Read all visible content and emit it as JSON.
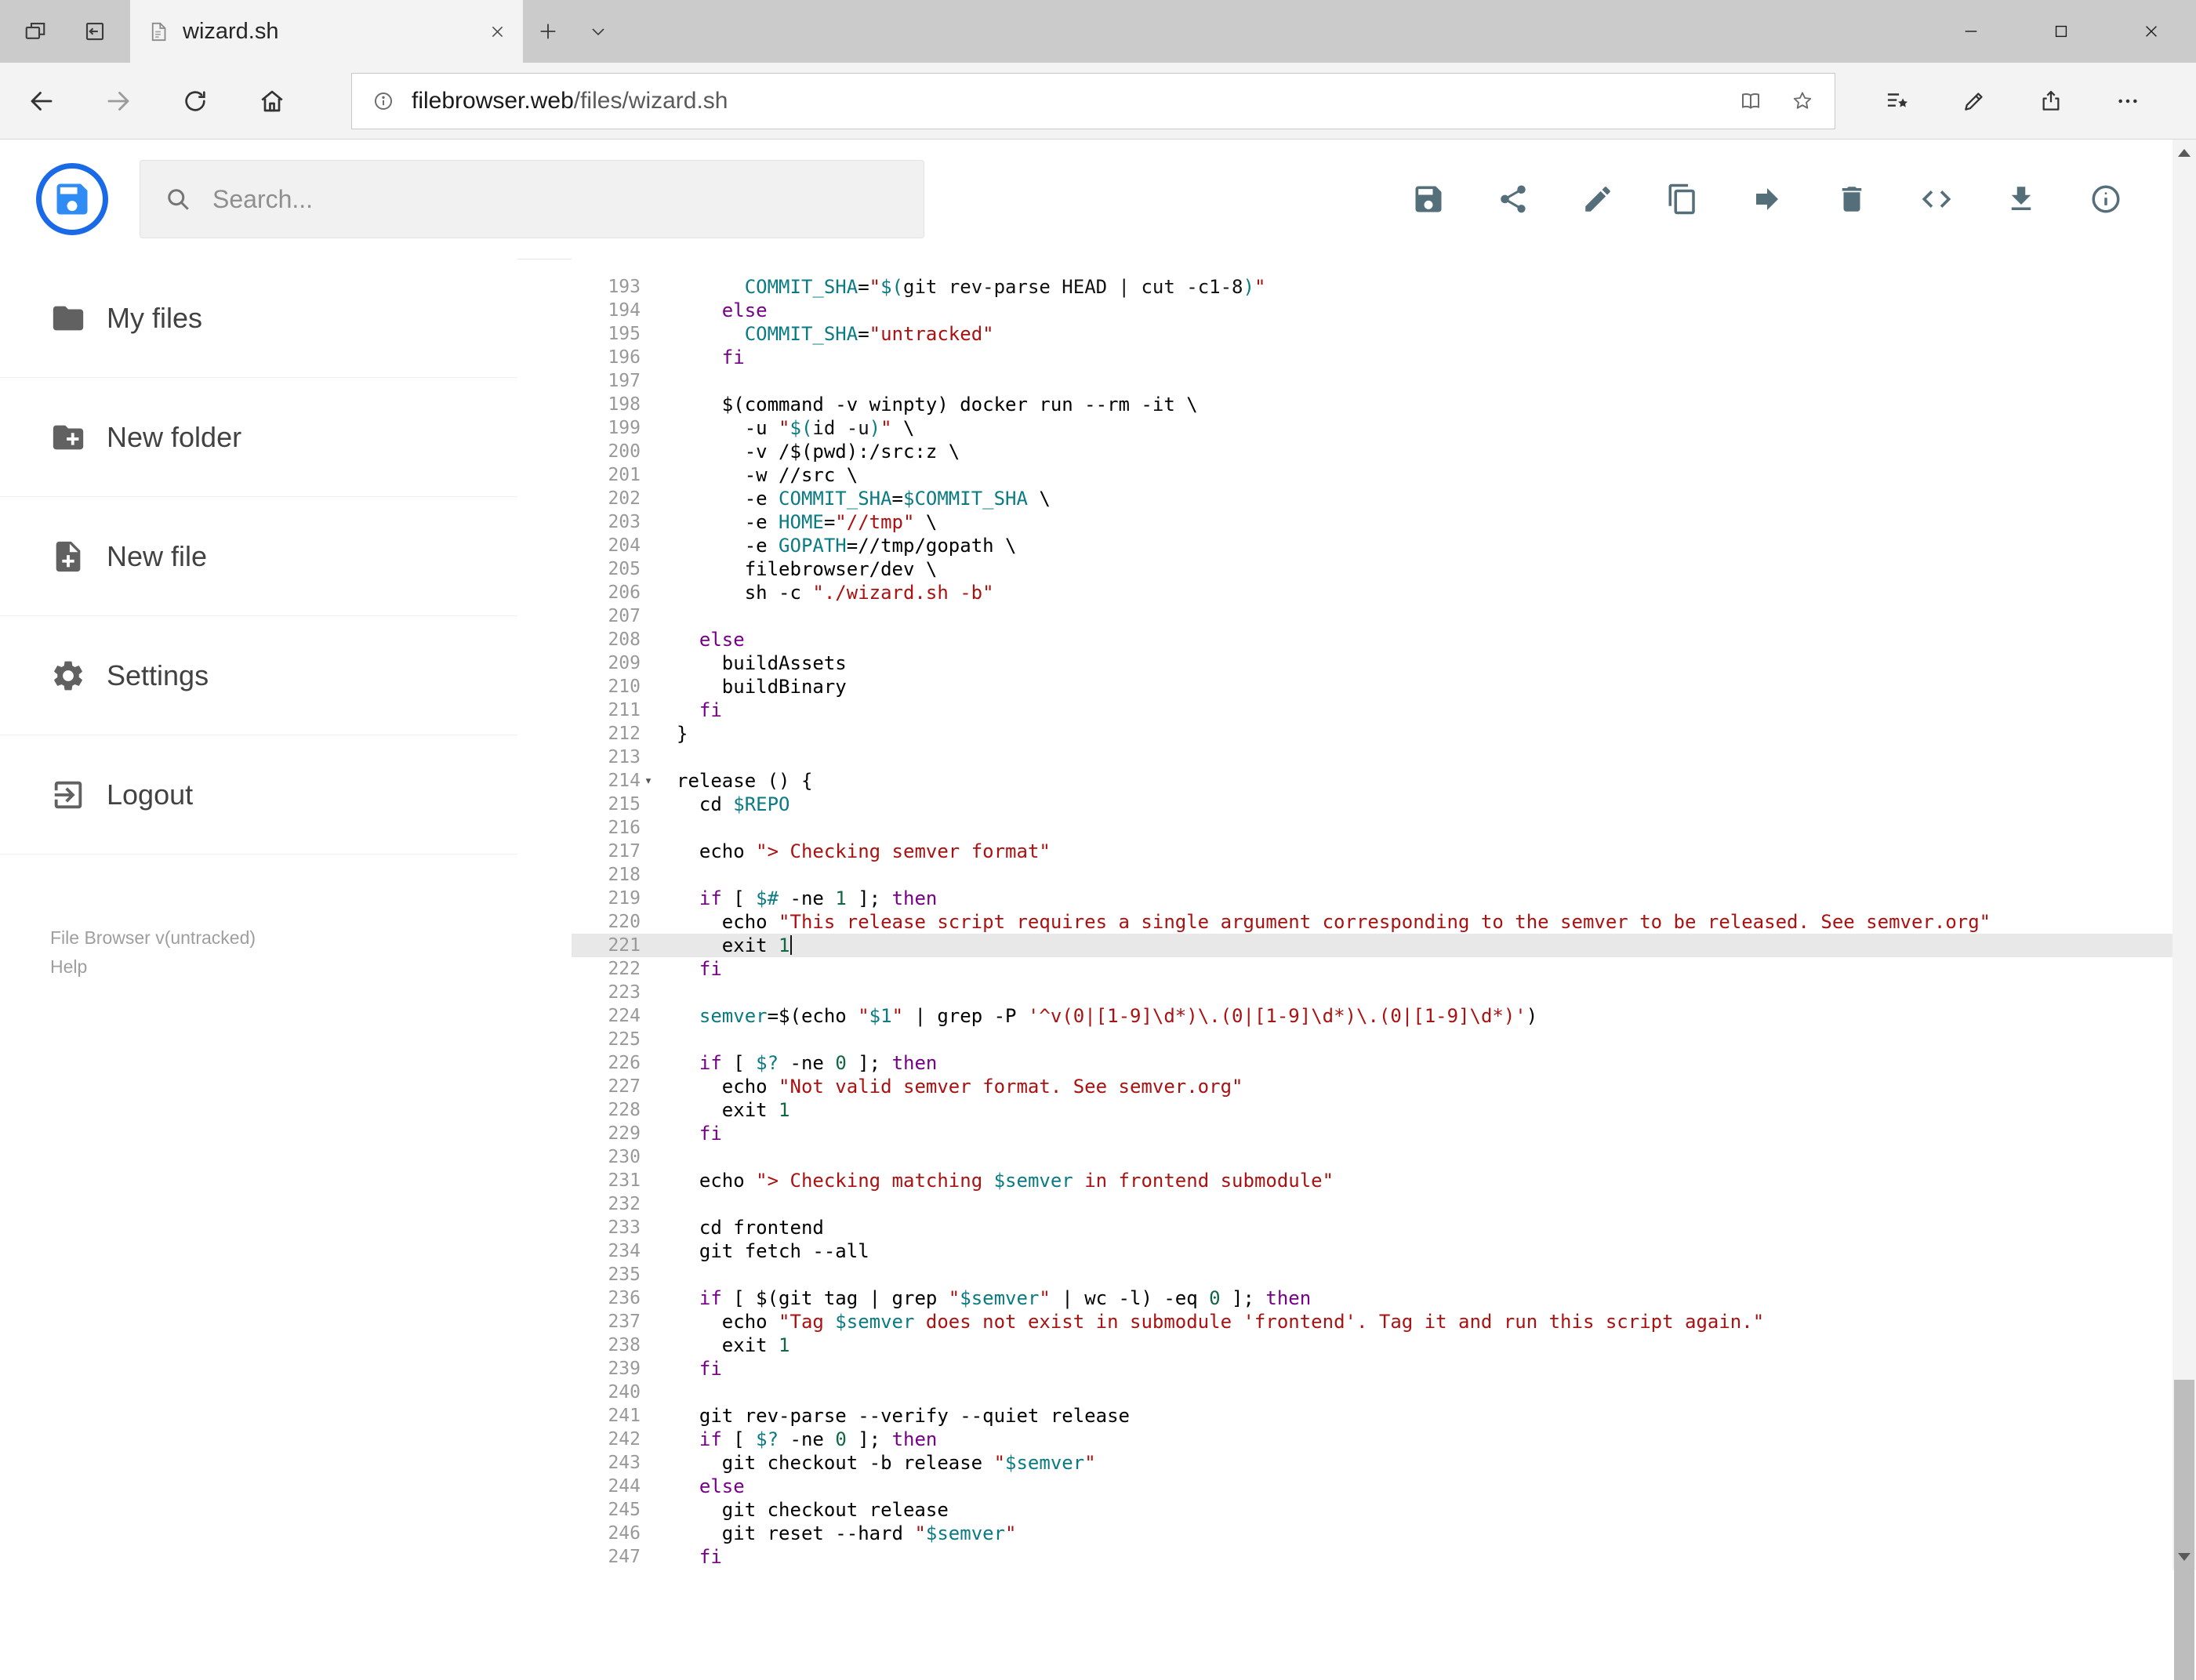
{
  "browser": {
    "tab_title": "wizard.sh",
    "url": {
      "domain": "filebrowser.web",
      "path": "/files/wizard.sh"
    }
  },
  "app": {
    "search_placeholder": "Search...",
    "toolbar_icons": [
      "save",
      "share",
      "rename",
      "copy",
      "move",
      "delete",
      "source-view",
      "download",
      "info"
    ],
    "sidebar": {
      "items": [
        {
          "label": "My files"
        },
        {
          "label": "New folder"
        },
        {
          "label": "New file"
        },
        {
          "label": "Settings"
        },
        {
          "label": "Logout"
        }
      ],
      "version_text": "File Browser v(untracked)",
      "help_text": "Help"
    },
    "editor": {
      "language": "shell",
      "first_line": 193,
      "active_line": 221,
      "cursor_line": 221,
      "fold_marker_line": 214,
      "colors": {
        "keyword": "#708",
        "string": "#a11",
        "variable": "#0a7b83",
        "number": "#164"
      },
      "lines": [
        "      COMMIT_SHA=\"$(git rev-parse HEAD | cut -c1-8)\"",
        "    else",
        "      COMMIT_SHA=\"untracked\"",
        "    fi",
        "",
        "    $(command -v winpty) docker run --rm -it \\",
        "      -u \"$(id -u)\" \\",
        "      -v /$(pwd):/src:z \\",
        "      -w //src \\",
        "      -e COMMIT_SHA=$COMMIT_SHA \\",
        "      -e HOME=\"//tmp\" \\",
        "      -e GOPATH=//tmp/gopath \\",
        "      filebrowser/dev \\",
        "      sh -c \"./wizard.sh -b\"",
        "",
        "  else",
        "    buildAssets",
        "    buildBinary",
        "  fi",
        "}",
        "",
        "release () {",
        "  cd $REPO",
        "",
        "  echo \"> Checking semver format\"",
        "",
        "  if [ $# -ne 1 ]; then",
        "    echo \"This release script requires a single argument corresponding to the semver to be released. See semver.org\"",
        "    exit 1",
        "  fi",
        "",
        "  semver=$(echo \"$1\" | grep -P '^v(0|[1-9]\\d*)\\.(0|[1-9]\\d*)\\.(0|[1-9]\\d*)')",
        "",
        "  if [ $? -ne 0 ]; then",
        "    echo \"Not valid semver format. See semver.org\"",
        "    exit 1",
        "  fi",
        "",
        "  echo \"> Checking matching $semver in frontend submodule\"",
        "",
        "  cd frontend",
        "  git fetch --all",
        "",
        "  if [ $(git tag | grep \"$semver\" | wc -l) -eq 0 ]; then",
        "    echo \"Tag $semver does not exist in submodule 'frontend'. Tag it and run this script again.\"",
        "    exit 1",
        "  fi",
        "",
        "  git rev-parse --verify --quiet release",
        "  if [ $? -ne 0 ]; then",
        "    git checkout -b release \"$semver\"",
        "  else",
        "    git checkout release",
        "    git reset --hard \"$semver\"",
        "  fi"
      ]
    }
  }
}
